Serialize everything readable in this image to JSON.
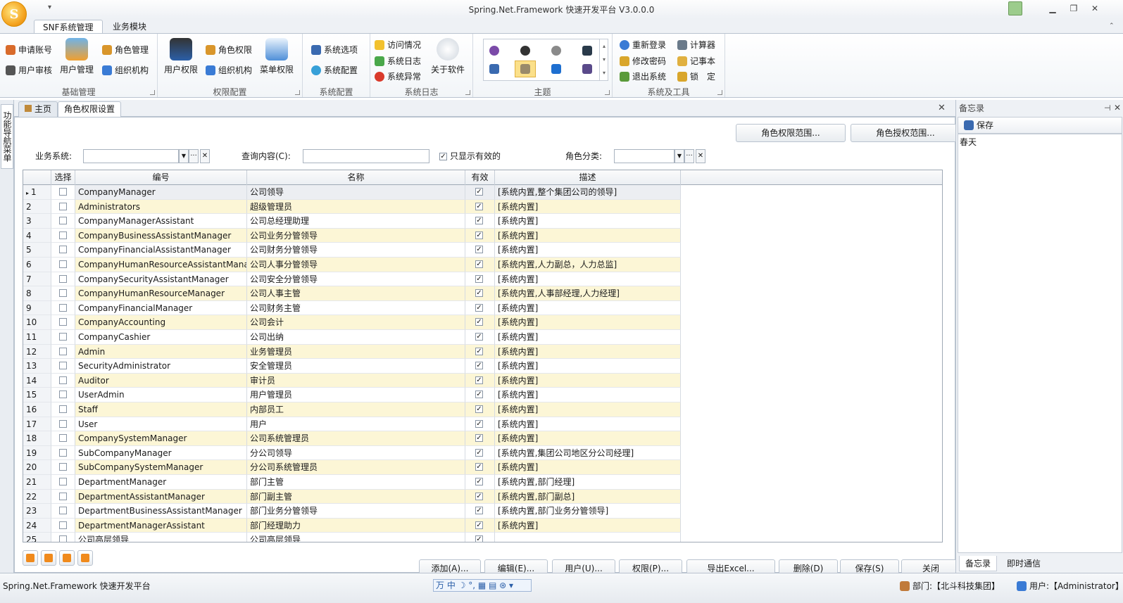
{
  "window": {
    "title": "Spring.Net.Framework 快速开发平台 V3.0.0.0",
    "qat": "▾"
  },
  "ribbon_tabs": [
    "SNF系统管理",
    "业务模块"
  ],
  "groups": {
    "basic": {
      "label": "基础管理",
      "items": [
        "申请账号",
        "用户审核",
        "用户管理",
        "角色管理",
        "组织机构"
      ]
    },
    "perm": {
      "label": "权限配置",
      "items": [
        "用户权限",
        "角色权限",
        "组织机构",
        "菜单权限"
      ]
    },
    "syscfg": {
      "label": "系统配置",
      "items": [
        "系统选项",
        "系统配置"
      ]
    },
    "syslog": {
      "label": "系统日志",
      "items": [
        "访问情况",
        "系统日志",
        "系统异常",
        "关于软件"
      ]
    },
    "theme": {
      "label": "主题"
    },
    "tools": {
      "label": "系统及工具",
      "items": [
        "重新登录",
        "修改密码",
        "退出系统",
        "计算器",
        "记事本",
        "锁　定"
      ]
    }
  },
  "left_strip": "功能导航菜单",
  "doc_tabs": [
    "主页",
    "角色权限设置"
  ],
  "actions": {
    "scope": "角色权限范围...",
    "grant": "角色授权范围..."
  },
  "filters": {
    "business_label": "业务系统:",
    "query_label": "查询内容(C):",
    "only_valid": "只显示有效的",
    "category_label": "角色分类:",
    "ellipsis": "···",
    "clear": "✕"
  },
  "grid": {
    "columns": [
      "选择",
      "编号",
      "名称",
      "有效",
      "描述"
    ],
    "rows": [
      [
        "1",
        "CompanyManager",
        "公司领导",
        "[系统内置,整个集团公司的领导]"
      ],
      [
        "2",
        "Administrators",
        "超级管理员",
        "[系统内置]"
      ],
      [
        "3",
        "CompanyManagerAssistant",
        "公司总经理助理",
        "[系统内置]"
      ],
      [
        "4",
        "CompanyBusinessAssistantManager",
        "公司业务分管领导",
        "[系统内置]"
      ],
      [
        "5",
        "CompanyFinancialAssistantManager",
        "公司财务分管领导",
        "[系统内置]"
      ],
      [
        "6",
        "CompanyHumanResourceAssistantManager",
        "公司人事分管领导",
        "[系统内置,人力副总，人力总监]"
      ],
      [
        "7",
        "CompanySecurityAssistantManager",
        "公司安全分管领导",
        "[系统内置]"
      ],
      [
        "8",
        "CompanyHumanResourceManager",
        "公司人事主管",
        "[系统内置,人事部经理,人力经理]"
      ],
      [
        "9",
        "CompanyFinancialManager",
        "公司财务主管",
        "[系统内置]"
      ],
      [
        "10",
        "CompanyAccounting",
        "公司会计",
        "[系统内置]"
      ],
      [
        "11",
        "CompanyCashier",
        "公司出纳",
        "[系统内置]"
      ],
      [
        "12",
        "Admin",
        "业务管理员",
        "[系统内置]"
      ],
      [
        "13",
        "SecurityAdministrator",
        "安全管理员",
        "[系统内置]"
      ],
      [
        "14",
        "Auditor",
        "审计员",
        "[系统内置]"
      ],
      [
        "15",
        "UserAdmin",
        "用户管理员",
        "[系统内置]"
      ],
      [
        "16",
        "Staff",
        "内部员工",
        "[系统内置]"
      ],
      [
        "17",
        "User",
        "用户",
        "[系统内置]"
      ],
      [
        "18",
        "CompanySystemManager",
        "公司系统管理员",
        "[系统内置]"
      ],
      [
        "19",
        "SubCompanyManager",
        "分公司领导",
        "[系统内置,集团公司地区分公司经理]"
      ],
      [
        "20",
        "SubCompanySystemManager",
        "分公司系统管理员",
        "[系统内置]"
      ],
      [
        "21",
        "DepartmentManager",
        "部门主管",
        "[系统内置,部门经理]"
      ],
      [
        "22",
        "DepartmentAssistantManager",
        "部门副主管",
        "[系统内置,部门副总]"
      ],
      [
        "23",
        "DepartmentBusinessAssistantManager",
        "部门业务分管领导",
        "[系统内置,部门业务分管领导]"
      ],
      [
        "24",
        "DepartmentManagerAssistant",
        "部门经理助力",
        "[系统内置]"
      ],
      [
        "25",
        "公司高层领导",
        "公司高层领导",
        ""
      ]
    ]
  },
  "buttons": [
    "添加(A)...",
    "编辑(E)...",
    "用户(U)...",
    "权限(P)...",
    "导出Excel...",
    "删除(D)",
    "保存(S)",
    "关闭"
  ],
  "memo": {
    "title": "备忘录",
    "save": "保存",
    "text": "春天",
    "tabs": [
      "备忘录",
      "即时通信"
    ]
  },
  "status": {
    "app": "Spring.Net.Framework 快速开发平台",
    "ime": "万 中 ☽ °, ▦ ▤ ⊛ ▾",
    "dept": "部门:【北斗科技集团】",
    "user": "用户:【Administrator】"
  }
}
